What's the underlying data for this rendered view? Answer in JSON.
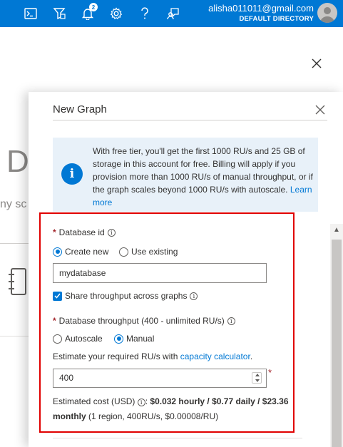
{
  "topbar": {
    "notification_count": "2",
    "account_email": "alisha011011@gmail.com",
    "account_directory": "DEFAULT DIRECTORY",
    "icons": [
      "cloud-shell-icon",
      "directory-filter-icon",
      "notifications-icon",
      "settings-icon",
      "help-icon",
      "feedback-icon"
    ]
  },
  "background_page": {
    "big_text": "D",
    "small_text": "ny sc"
  },
  "panel": {
    "title": "New Graph",
    "info_text": "With free tier, you'll get the first 1000 RU/s and 25 GB of storage in this account for free. Billing will apply if you provision more than 1000 RU/s of manual throughput, or if the graph scales beyond 1000 RU/s with autoscale.",
    "info_link": "Learn more"
  },
  "form": {
    "database_id_label": "Database id",
    "create_new_label": "Create new",
    "use_existing_label": "Use existing",
    "selected_database_mode": "Create new",
    "database_input_value": "mydatabase",
    "share_throughput_label": "Share throughput across graphs",
    "share_throughput_checked": true,
    "throughput_label": "Database throughput (400 - unlimited RU/s)",
    "autoscale_label": "Autoscale",
    "manual_label": "Manual",
    "selected_throughput_mode": "Manual",
    "estimate_text": "Estimate your required RU/s with",
    "capacity_link": "capacity calculator",
    "estimate_period": ".",
    "throughput_value": "400",
    "required_star": "*",
    "cost_label": "Estimated cost (USD)",
    "cost_colon": ":",
    "cost_values": "$0.032 hourly / $0.77 daily / $23.36 monthly",
    "cost_detail": "(1 region, 400RU/s, $0.00008/RU)"
  },
  "colors": {
    "brand": "#0078d4",
    "required": "#a4262c",
    "highlight_border": "#e00000",
    "info_bg": "#e8f1f9"
  }
}
